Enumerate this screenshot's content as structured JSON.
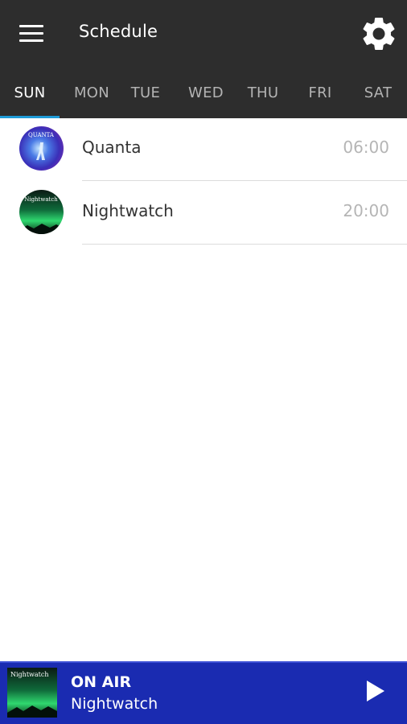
{
  "header": {
    "title": "Schedule",
    "icons": {
      "menu": "hamburger-menu-icon",
      "settings": "gear-icon"
    }
  },
  "days": {
    "tabs": [
      "SUN",
      "MON",
      "TUE",
      "WED",
      "THU",
      "FRI",
      "SAT"
    ],
    "selected": "SUN"
  },
  "schedule": [
    {
      "title": "Quanta",
      "time": "06:00",
      "thumbnail_text": "QUANTA"
    },
    {
      "title": "Nightwatch",
      "time": "20:00",
      "thumbnail_text": "Nightwatch"
    }
  ],
  "player": {
    "status": "ON AIR",
    "title": "Nightwatch",
    "thumbnail_text": "Nightwatch",
    "play_icon": "play-icon"
  },
  "colors": {
    "app_bar": "#2d2d2d",
    "tab_indicator": "#1e9bd7",
    "player_bar": "#1a2bb1"
  }
}
